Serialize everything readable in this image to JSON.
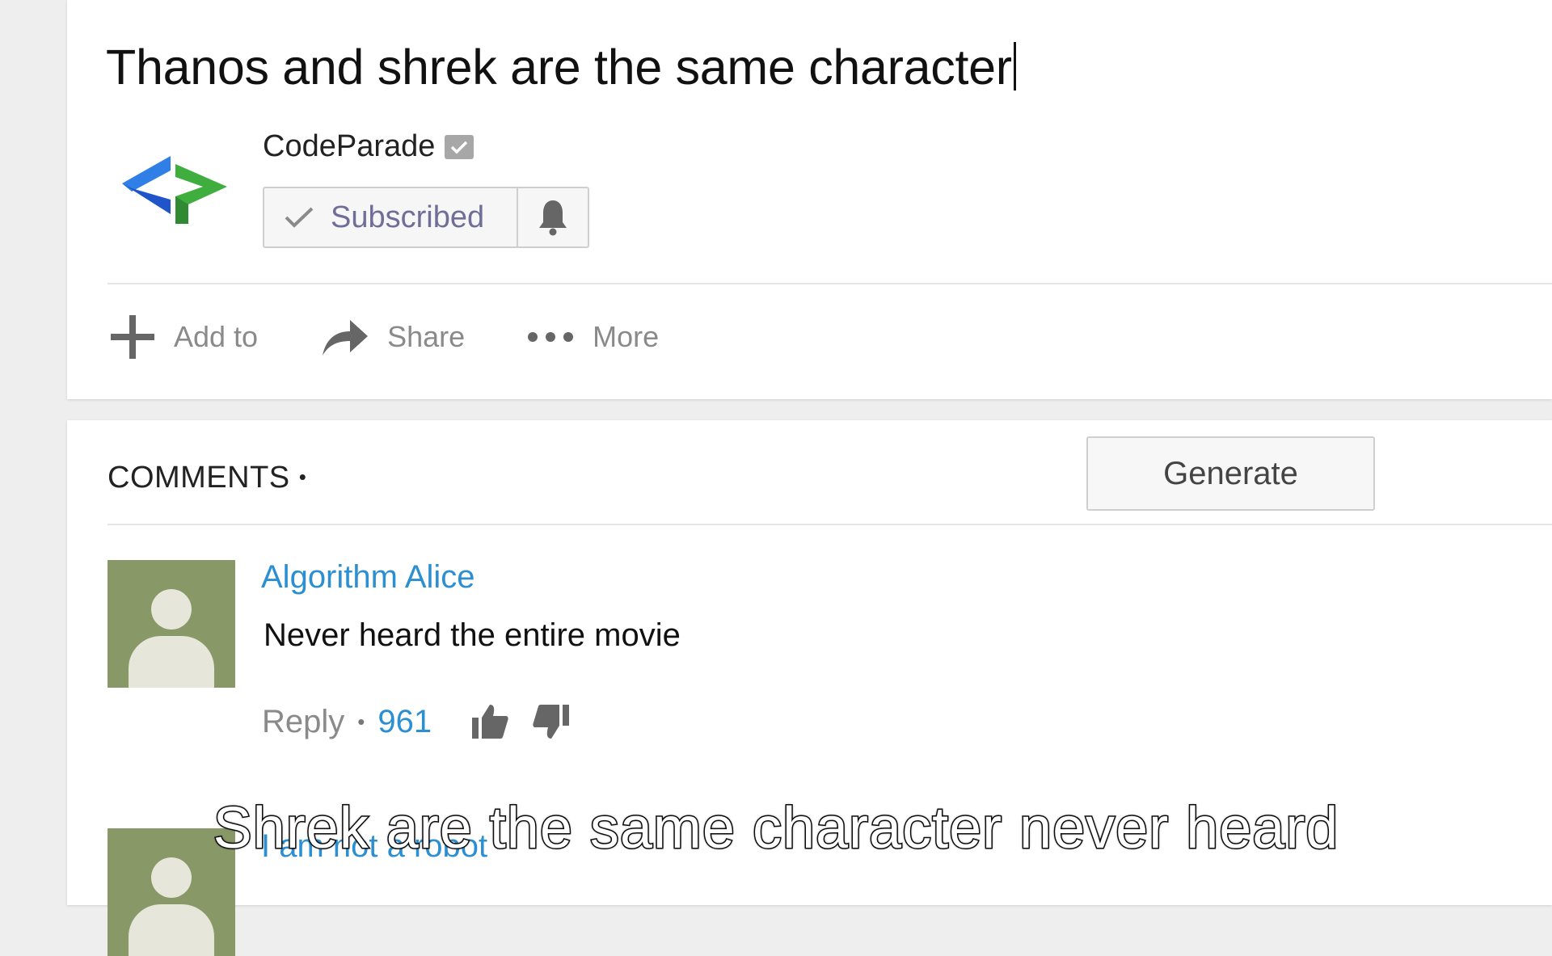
{
  "video": {
    "title": "Thanos and shrek are the same character",
    "channel_name": "CodeParade",
    "subscribe_label": "Subscribed",
    "actions": [
      {
        "label": "Add to",
        "icon": "plus-icon"
      },
      {
        "label": "Share",
        "icon": "share-arrow-icon"
      },
      {
        "label": "More",
        "icon": "more-dots-icon"
      }
    ]
  },
  "comments": {
    "header": "COMMENTS",
    "header_dot": "•",
    "generate_label": "Generate",
    "items": [
      {
        "author": "Algorithm Alice",
        "text": "Never heard the entire movie",
        "reply_label": "Reply",
        "separator": "•",
        "likes": "961"
      },
      {
        "author": "I am not a robot"
      }
    ]
  },
  "subtitle": "Shrek are the same character never heard",
  "colors": {
    "link_blue": "#2b8fd1",
    "avatar_green": "#889867",
    "subscribed_text": "#6e6e98",
    "logo_blue": "#2f7fe6",
    "logo_green": "#3fae3f"
  }
}
